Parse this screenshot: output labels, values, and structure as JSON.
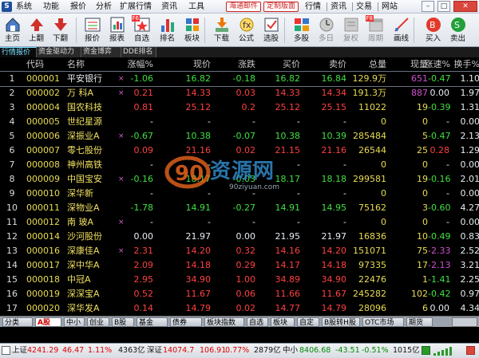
{
  "menu": {
    "logo": "S",
    "items": [
      "系统",
      "功能",
      "报价",
      "分析",
      "扩展行情",
      "资讯",
      "工具"
    ],
    "right": [
      "海通邮件",
      "定制版面"
    ],
    "right_items": [
      "行情",
      "资讯",
      "交易",
      "网站"
    ]
  },
  "toolbar": {
    "buttons": [
      {
        "label": "主页",
        "icon": "home-icon"
      },
      {
        "label": "上翻",
        "icon": "page-up-icon"
      },
      {
        "label": "下翻",
        "icon": "page-down-icon"
      },
      {
        "label": "报价",
        "icon": "quote-icon"
      },
      {
        "label": "报表",
        "icon": "report-icon"
      },
      {
        "label": "自选",
        "icon": "watchlist-icon",
        "badge": "F6"
      },
      {
        "label": "排名",
        "icon": "ranking-icon"
      },
      {
        "label": "板块",
        "icon": "sector-icon"
      },
      {
        "label": "下载",
        "icon": "download-icon"
      },
      {
        "label": "公式",
        "icon": "formula-icon"
      },
      {
        "label": "选股",
        "icon": "stock-pick-icon"
      },
      {
        "label": "多股",
        "icon": "multi-stock-icon"
      },
      {
        "label": "多日",
        "icon": "multi-day-icon"
      },
      {
        "label": "复权",
        "icon": "adjust-icon"
      },
      {
        "label": "周期",
        "icon": "period-icon",
        "badge": "F8"
      },
      {
        "label": "画线",
        "icon": "draw-line-icon"
      },
      {
        "label": "买入",
        "icon": "buy-icon"
      },
      {
        "label": "卖出",
        "icon": "sell-icon"
      }
    ]
  },
  "tabs": [
    "行情报价",
    "资金驱动力",
    "资金博弈",
    "DDE排名"
  ],
  "table": {
    "headers": [
      "代码",
      "名称",
      "·",
      "涨幅%",
      "现价",
      "涨跌",
      "买价",
      "卖价",
      "总量",
      "现量",
      "涨速%",
      "换手%"
    ],
    "rows": [
      {
        "idx": "1",
        "code": "000001",
        "name": "平安银行",
        "mark": "×",
        "pct": "-1.06",
        "price": "16.82",
        "chg": "-0.18",
        "buy": "16.82",
        "sell": "16.84",
        "vol": "129.9万",
        "now": "651",
        "spd": "-0.47",
        "turn": "1.10",
        "dir": "dn",
        "nowc": "mg"
      },
      {
        "idx": "2",
        "code": "000002",
        "name": "万 科A",
        "mark": "×",
        "pct": "0.21",
        "price": "14.33",
        "chg": "0.03",
        "buy": "14.33",
        "sell": "14.34",
        "vol": "191.3万",
        "now": "887",
        "spd": "0.00",
        "turn": "1.97",
        "dir": "up",
        "nowc": "mg",
        "spdc": "fl"
      },
      {
        "idx": "3",
        "code": "000004",
        "name": "国农科技",
        "mark": "",
        "pct": "0.81",
        "price": "25.12",
        "chg": "0.2",
        "buy": "25.12",
        "sell": "25.15",
        "vol": "11022",
        "now": "19",
        "spd": "-0.39",
        "turn": "1.31",
        "dir": "up",
        "nowc": "yl",
        "spdc": "dn"
      },
      {
        "idx": "4",
        "code": "000005",
        "name": "世纪星源",
        "mark": "",
        "pct": "-",
        "price": "-",
        "chg": "-",
        "buy": "-",
        "sell": "-",
        "vol": "0",
        "now": "0",
        "spd": "-",
        "turn": "0.00",
        "dir": "fl",
        "nowc": "yl"
      },
      {
        "idx": "5",
        "code": "000006",
        "name": "深振业A",
        "mark": "×",
        "pct": "-0.67",
        "price": "10.38",
        "chg": "-0.07",
        "buy": "10.38",
        "sell": "10.39",
        "vol": "285484",
        "now": "5",
        "spd": "-0.47",
        "turn": "2.13",
        "dir": "dn",
        "nowc": "yl"
      },
      {
        "idx": "6",
        "code": "000007",
        "name": "零七股份",
        "mark": "",
        "pct": "0.09",
        "price": "21.16",
        "chg": "0.02",
        "buy": "21.15",
        "sell": "21.16",
        "vol": "26544",
        "now": "25",
        "spd": "0.28",
        "turn": "1.29",
        "dir": "up",
        "nowc": "yl"
      },
      {
        "idx": "7",
        "code": "000008",
        "name": "神州高铁",
        "mark": "",
        "pct": "-",
        "price": "-",
        "chg": "-",
        "buy": "-",
        "sell": "-",
        "vol": "0",
        "now": "0",
        "spd": "-",
        "turn": "0.00",
        "dir": "fl",
        "nowc": "yl"
      },
      {
        "idx": "8",
        "code": "000009",
        "name": "中国宝安",
        "mark": "×",
        "pct": "-0.16",
        "price": "18.17",
        "chg": "-0.03",
        "buy": "18.17",
        "sell": "18.18",
        "vol": "299581",
        "now": "19",
        "spd": "-0.16",
        "turn": "2.01",
        "dir": "dn",
        "nowc": "yl"
      },
      {
        "idx": "9",
        "code": "000010",
        "name": "深华新",
        "mark": "",
        "pct": "-",
        "price": "-",
        "chg": "-",
        "buy": "-",
        "sell": "-",
        "vol": "0",
        "now": "0",
        "spd": "-",
        "turn": "0.00",
        "dir": "fl",
        "nowc": "yl"
      },
      {
        "idx": "10",
        "code": "000011",
        "name": "深物业A",
        "mark": "",
        "pct": "-1.78",
        "price": "14.91",
        "chg": "-0.27",
        "buy": "14.91",
        "sell": "14.95",
        "vol": "75162",
        "now": "3",
        "spd": "-0.60",
        "turn": "4.27",
        "dir": "dn",
        "nowc": "yl"
      },
      {
        "idx": "11",
        "code": "000012",
        "name": "南 玻A",
        "mark": "×",
        "pct": "-",
        "price": "-",
        "chg": "-",
        "buy": "-",
        "sell": "-",
        "vol": "0",
        "now": "0",
        "spd": "-",
        "turn": "0.00",
        "dir": "fl",
        "nowc": "yl"
      },
      {
        "idx": "12",
        "code": "000014",
        "name": "沙河股份",
        "mark": "",
        "pct": "0.00",
        "price": "21.97",
        "chg": "0.00",
        "buy": "21.95",
        "sell": "21.97",
        "vol": "16836",
        "now": "10",
        "spd": "-0.49",
        "turn": "0.83",
        "dir": "fl",
        "nowc": "yl",
        "spdc": "dn"
      },
      {
        "idx": "13",
        "code": "000016",
        "name": "深康佳A",
        "mark": "×",
        "pct": "2.31",
        "price": "14.20",
        "chg": "0.32",
        "buy": "14.16",
        "sell": "14.20",
        "vol": "151071",
        "now": "75",
        "spd": "-2.33",
        "turn": "2.52",
        "dir": "up",
        "nowc": "yl",
        "spdc": "mg"
      },
      {
        "idx": "14",
        "code": "000017",
        "name": "深中华A",
        "mark": "",
        "pct": "2.09",
        "price": "14.18",
        "chg": "0.29",
        "buy": "14.17",
        "sell": "14.18",
        "vol": "97335",
        "now": "17",
        "spd": "-2.13",
        "turn": "3.21",
        "dir": "up",
        "nowc": "yl",
        "spdc": "mg"
      },
      {
        "idx": "15",
        "code": "000018",
        "name": "中冠A",
        "mark": "",
        "pct": "2.95",
        "price": "34.90",
        "chg": "1.00",
        "buy": "34.89",
        "sell": "34.90",
        "vol": "22476",
        "now": "1",
        "spd": "-1.41",
        "turn": "2.25",
        "dir": "up",
        "nowc": "yl",
        "spdc": "dn"
      },
      {
        "idx": "16",
        "code": "000019",
        "name": "深深宝A",
        "mark": "",
        "pct": "0.52",
        "price": "11.67",
        "chg": "0.06",
        "buy": "11.66",
        "sell": "11.67",
        "vol": "245282",
        "now": "102",
        "spd": "-0.42",
        "turn": "0.97",
        "dir": "up",
        "nowc": "yl",
        "spdc": "dn"
      },
      {
        "idx": "17",
        "code": "000020",
        "name": "深华发A",
        "mark": "",
        "pct": "0.14",
        "price": "14.79",
        "chg": "0.02",
        "buy": "14.77",
        "sell": "14.79",
        "vol": "28096",
        "now": "6",
        "spd": "0.00",
        "turn": "4.34",
        "dir": "up",
        "nowc": "yl",
        "spdc": "fl"
      }
    ]
  },
  "watermark": {
    "big": "资源网",
    "small": "90ziyuan.com"
  },
  "bottom_tabs": [
    "分类",
    "A股",
    "中小",
    "创业",
    "B股",
    "基金",
    "债券",
    "板块指数",
    "自选",
    "板块",
    "自定",
    "B股转H股",
    "OTC市场",
    "期货"
  ],
  "status": {
    "sh_label": "上证",
    "sh_val": "4241.29",
    "sh_chg": "46.47",
    "sh_pct": "1.11%",
    "sh_amt": "4363亿",
    "sz_label": "深证",
    "sz_val": "14074.7",
    "sz_chg": "106.91",
    "sz_pct": "0.77%",
    "sz_amt": "2879亿",
    "zx_label": "中小",
    "zx_val": "8406.68",
    "zx_chg": "-43.51",
    "zx_pct": "-0.51%",
    "zx_amt": "1015亿"
  }
}
